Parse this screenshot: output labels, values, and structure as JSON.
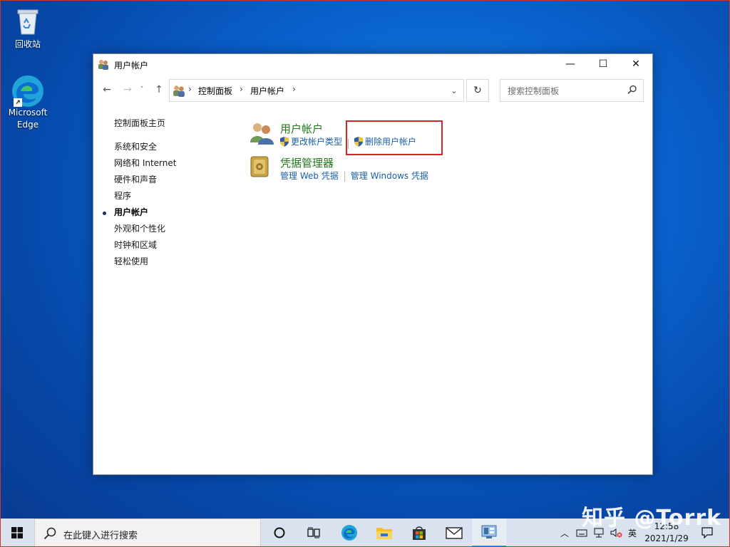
{
  "desktop": {
    "icons": [
      {
        "label": "回收站"
      },
      {
        "label": "Microsoft Edge"
      }
    ]
  },
  "window": {
    "title": "用户帐户",
    "controls": {
      "minimize": "—",
      "maximize": "☐",
      "close": "✕"
    },
    "breadcrumbs": [
      "控制面板",
      "用户帐户"
    ],
    "search_placeholder": "搜索控制面板"
  },
  "sidebar": {
    "items": [
      {
        "label": "控制面板主页"
      },
      {
        "label": "系统和安全"
      },
      {
        "label": "网络和 Internet"
      },
      {
        "label": "硬件和声音"
      },
      {
        "label": "程序"
      },
      {
        "label": "用户帐户",
        "active": true
      },
      {
        "label": "外观和个性化"
      },
      {
        "label": "时钟和区域"
      },
      {
        "label": "轻松使用"
      }
    ]
  },
  "main": {
    "categories": [
      {
        "title": "用户帐户",
        "links": [
          {
            "label": "更改帐户类型",
            "shield": true
          },
          {
            "label": "删除用户帐户",
            "shield": true,
            "highlighted": true
          }
        ]
      },
      {
        "title": "凭据管理器",
        "links": [
          {
            "label": "管理 Web 凭据",
            "shield": false
          },
          {
            "label": "管理 Windows 凭据",
            "shield": false
          }
        ]
      }
    ]
  },
  "taskbar": {
    "search_text": "在此键入进行搜索",
    "input_method": "英",
    "time": "12:58",
    "date": "2021/1/29"
  },
  "watermark": "知乎 @Torrk",
  "colors": {
    "category_title": "#217a1c",
    "link": "#1b5fa8",
    "highlight_box": "#d22626",
    "desktop_bg": "#0a63cf"
  }
}
